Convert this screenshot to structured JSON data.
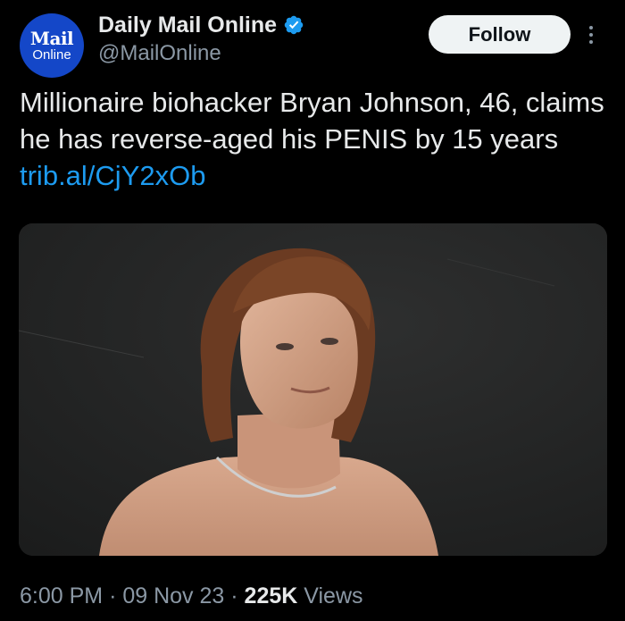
{
  "account": {
    "avatar_line1": "Mail",
    "avatar_line2": "Online",
    "display_name": "Daily Mail Online",
    "handle": "@MailOnline",
    "verified": true
  },
  "actions": {
    "follow_label": "Follow"
  },
  "tweet": {
    "text": "Millionaire biohacker Bryan Johnson, 46, claims he has reverse-aged his PENIS by 15 years",
    "link": "trib.al/CjY2xOb"
  },
  "media": {
    "type": "photo"
  },
  "meta": {
    "time": "6:00 PM",
    "separator": "·",
    "date": "09 Nov 23",
    "views_count": "225K",
    "views_label": "Views"
  },
  "icons": {
    "verified": "verified-badge-icon",
    "more": "more-options-icon"
  },
  "colors": {
    "background": "#000000",
    "text": "#e7e9ea",
    "secondary_text": "#8b98a5",
    "link": "#1d9bf0",
    "verified": "#1d9bf0",
    "avatar_bg": "#1447c8",
    "follow_bg": "#eff3f4"
  }
}
